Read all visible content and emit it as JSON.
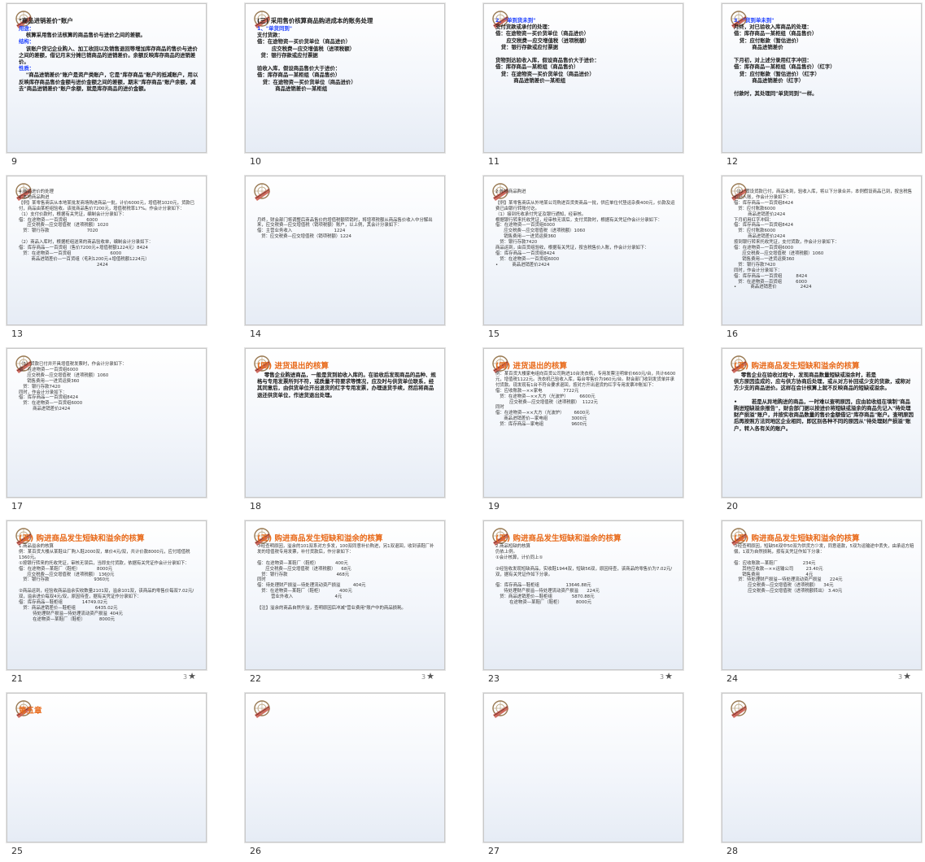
{
  "slides": [
    {
      "num": "9",
      "lines": [
        {
          "c": "t-title",
          "t": "\"商品进销差价\"账户"
        },
        {
          "c": "t-blue",
          "t": "用途："
        },
        {
          "c": "b",
          "t": "    核算采用售价法核算的商品售价与进价之间的差额。"
        },
        {
          "c": "t-blue",
          "t": "结构："
        },
        {
          "c": "b",
          "t": "    该账户贷记企业购入、加工收回以及销售退回等增加库存商品的售价与进价之间的差额，借记月末分摊已销商品的进销差价。余额反映库存商品的进销差价。"
        },
        {
          "c": "t-blue",
          "t": "性质："
        },
        {
          "c": "b",
          "t": "    \"商品进销差价\"账户是资产类账户，它是\"库存商品\"账户的抵减账户，用以反映库存商品售价金额与进价金额之间的差额，期末\"库存商品\"账户余额，减去\"商品进销差价\"账户余额，就是库存商品的进价金额。"
        }
      ]
    },
    {
      "num": "10",
      "lines": [
        {
          "c": "t-title",
          "t": "(三) 采用售价核算商品购进成本的账务处理"
        },
        {
          "c": "t-blue",
          "t": "1、\"单货同到\""
        },
        {
          "c": "b",
          "t": "支付货款："
        },
        {
          "c": "b",
          "t": "借：在途物资—买价货单位（商品进价）"
        },
        {
          "c": "b",
          "t": "        应交税费—应交增值税（进项税额）"
        },
        {
          "c": "b",
          "t": "  贷：银行存款或应付票据"
        },
        {
          "c": "b",
          "t": " "
        },
        {
          "c": "b",
          "t": "验收入库，假设商品售价大于进价："
        },
        {
          "c": "b",
          "t": "借：库存商品—某柜组（商品售价）"
        },
        {
          "c": "b",
          "t": "   贷：在途物资—买价货单位（商品进价）"
        },
        {
          "c": "b",
          "t": "          商品进销差价—某柜组"
        }
      ]
    },
    {
      "num": "11",
      "lines": [
        {
          "c": "t-blue",
          "t": "2、\"单到货未到\""
        },
        {
          "c": "b",
          "t": "支付货款或承付的处理："
        },
        {
          "c": "b",
          "t": "借：在途物资—买价货单位（商品进价）"
        },
        {
          "c": "b",
          "t": "      应交税费—应交增值税（进项税额）"
        },
        {
          "c": "b",
          "t": "   贷：银行存款或应付票据"
        },
        {
          "c": "b",
          "t": " "
        },
        {
          "c": "b",
          "t": "货物到达验收入库，假设商品售价大于进价："
        },
        {
          "c": "b",
          "t": "借：库存商品—某柜组（商品售价）"
        },
        {
          "c": "b",
          "t": "   贷：在途物资—买价货单位（商品进价）"
        },
        {
          "c": "b",
          "t": "          商品进销差价—某柜组"
        }
      ]
    },
    {
      "num": "12",
      "lines": [
        {
          "c": "t-blue",
          "t": "3、\"货到单未到\""
        },
        {
          "c": "b",
          "t": "月终，对已验收入库商品的处理："
        },
        {
          "c": "b",
          "t": "借：库存商品—某柜组（商品售价）"
        },
        {
          "c": "b",
          "t": "   贷：应付账款（暂估进价）"
        },
        {
          "c": "b",
          "t": "          商品进销差价"
        },
        {
          "c": "b",
          "t": " "
        },
        {
          "c": "b",
          "t": "下月初，对上述分录用红字冲回："
        },
        {
          "c": "b",
          "t": "借：库存商品—某柜组（商品售价）（红字）"
        },
        {
          "c": "b",
          "t": "   贷：应付账款（暂估进价）（红字）"
        },
        {
          "c": "b",
          "t": "          商品进销差价（红字）"
        },
        {
          "c": "b",
          "t": " "
        },
        {
          "c": "b",
          "t": "付款时，其处理同\"单货同到\"一样。"
        }
      ]
    },
    {
      "num": "13",
      "dense": true,
      "lines": [
        {
          "c": "",
          "t": "4.商品进价的处理"
        },
        {
          "c": "",
          "t": "1.本地商品购进"
        },
        {
          "c": "",
          "t": "【例】某零售商店从本地某批发商场购进商品一批，计价6000元，增值税1020元，货款已付，商品由某柜组验收。该批商品售价7200元，增值税税率17%。作会计分录如下："
        },
        {
          "c": "",
          "t": "（1）支付价款时，根据有关凭证，编制会计分录如下："
        },
        {
          "c": "",
          "t": "借：在途物资—一百货组              6000"
        },
        {
          "c": "",
          "t": "      应交税费—应交增值税（进项税额）1020"
        },
        {
          "c": "",
          "t": "   贷：银行存款                           7020"
        },
        {
          "c": "",
          "t": " "
        },
        {
          "c": "",
          "t": "（2）商品入库时，根据柜组送来的商品验收单，编制会计分录如下："
        },
        {
          "c": "",
          "t": "借：库存商品—一百货组（售价7200元+增值税额1224元）8424"
        },
        {
          "c": "",
          "t": "   贷：在途物资—一百货组                            6000"
        },
        {
          "c": "",
          "t": "         商品进销差价—一百货组（毛利1200元+增值税额1224元）"
        },
        {
          "c": "",
          "t": "                                                        2424"
        }
      ]
    },
    {
      "num": "14",
      "dense": true,
      "lines": [
        {
          "c": "",
          "t": " "
        },
        {
          "c": "",
          "t": " "
        },
        {
          "c": "",
          "t": " "
        },
        {
          "c": "",
          "t": " "
        },
        {
          "c": "",
          "t": " "
        },
        {
          "c": "",
          "t": "月终，财会部门将调整后商品售价的增值税额转销时，将增项税额从商品售价收入中分解出来，应交税费—应交增值税（销项税额）账户，以上例，其会计分录如下："
        },
        {
          "c": "",
          "t": "借：主营业务收入                              1224"
        },
        {
          "c": "",
          "t": "   贷：应交税费—应交增值税（销项税额）1224"
        }
      ]
    },
    {
      "num": "15",
      "dense": true,
      "lines": [
        {
          "c": "",
          "t": "2.外地商品购进"
        },
        {
          "c": "",
          "t": " "
        },
        {
          "c": "",
          "t": "【例】某零售商店从外地某公司购进百货类商品一批，供应单位代垫运杂费400元，价款及运费已由银行转账付讫。"
        },
        {
          "c": "",
          "t": "（1）接到托收承付凭证及银行通知，经审核。"
        },
        {
          "c": "",
          "t": "根据银行转来托收凭证，经审核无误后，支付货款时，根据有关凭证作会计分录如下："
        },
        {
          "c": "",
          "t": "借：在途物资—一百货组6000"
        },
        {
          "c": "",
          "t": "      应交税费—应交增值税（进项税额）1060"
        },
        {
          "c": "",
          "t": "      销售费用—一进货运费360"
        },
        {
          "c": "",
          "t": "   贷：银行存款7420"
        },
        {
          "c": "",
          "t": "商品运到，由百货组验收，根据有关凭证，按含税售价入账，作会计分录如下："
        },
        {
          "c": "",
          "t": "借：库存商品—一百货组8424"
        },
        {
          "c": "",
          "t": "   贷：在途物资—一百货组6000"
        },
        {
          "c": "",
          "t": "•          商品进销差价2424"
        }
      ]
    },
    {
      "num": "16",
      "dense": true,
      "lines": [
        {
          "c": "",
          "t": "（2）假设货款已付，商品未到，验收入库，将以下分录合并。本例假设商品已到，按含税售价记入账，作会计分录如下："
        },
        {
          "c": "",
          "t": "借：库存商品—一百货组8424"
        },
        {
          "c": "",
          "t": "   贷：应付账款6000"
        },
        {
          "c": "",
          "t": "          商品进销差价2424"
        },
        {
          "c": "",
          "t": "下月初用红字冲回："
        },
        {
          "c": "",
          "t": "借：库存商品—一百货组8424"
        },
        {
          "c": "",
          "t": "   贷：应付账款6000"
        },
        {
          "c": "",
          "t": "          商品进销差价2424"
        },
        {
          "c": "",
          "t": "按到银行转来托收凭证，支付货款，作会计分录如下："
        },
        {
          "c": "",
          "t": "借：在途物资—一百货组6000"
        },
        {
          "c": "",
          "t": "      应交税费—应交增值税（进项税额）1060"
        },
        {
          "c": "",
          "t": "      销售费用—一进货运费360"
        },
        {
          "c": "",
          "t": "   贷：银行存款7420"
        },
        {
          "c": "",
          "t": "同时，作会计分录如下："
        },
        {
          "c": "",
          "t": "借：库存商品—一百货组          8424"
        },
        {
          "c": "",
          "t": "   贷：在途物资—百货组          6000"
        },
        {
          "c": "",
          "t": "•          商品进销差价                 2424"
        }
      ]
    },
    {
      "num": "17",
      "dense": true,
      "lines": [
        {
          "c": "",
          "t": "（3）货款已付并开具增值税发票时，作会计分录如下："
        },
        {
          "c": "",
          "t": "借：在途物资—一百货组6000"
        },
        {
          "c": "",
          "t": "      应交税费—应交增值税（进项税额）1060"
        },
        {
          "c": "",
          "t": "      销售费用—一进货运费360"
        },
        {
          "c": "",
          "t": "   贷：银行存款7420"
        },
        {
          "c": "",
          "t": "同时，作会计分录如下："
        },
        {
          "c": "",
          "t": "借：库存商品—一百货组8424"
        },
        {
          "c": "",
          "t": "   贷：在途物资—一百货组6000"
        },
        {
          "c": "",
          "t": "          商品进销差价2424"
        }
      ]
    },
    {
      "num": "18",
      "lines": [
        {
          "c": "t-orange",
          "t": "(四) 进货退出的核算"
        },
        {
          "c": "b",
          "t": "    零售企业购进商品，一般是货到验收入库的。在验收后发现商品的品种、规格与专用发票所列不符，或质量不符要求等情况，应及时与供货单位联系，经其同意后，由供货单位开出退货的红字专用发票，办理退货手续，然后将商品退还供货单位，作进货退出处理。"
        }
      ]
    },
    {
      "num": "19",
      "dense": true,
      "lines": [
        {
          "c": "t-orange",
          "t": "(四) 进货退出的核算"
        },
        {
          "c": "",
          "t": "例：某百货大楼家电组向百货公司购进10台洗衣机，专用发票注明单价660元/台，共计6600元，增值税1122元。洗衣机已验收入库，每台零售价为960元/台。财会部门收到发货单并承付货款。现发现有1台不符合要求退回，按对方开出退货的红字专用发票冲账如下："
        },
        {
          "c": "",
          "t": "借：应收账款—××家电               7722元"
        },
        {
          "c": "",
          "t": "   贷：在途物资—××大方（光波炉）        6600元"
        },
        {
          "c": "",
          "t": "          应交税费—应交增值税（进项税额）  1122元"
        },
        {
          "c": "",
          "t": "同时"
        },
        {
          "c": "",
          "t": "借：在途物资—××大方（光波炉）       6600元"
        },
        {
          "c": "",
          "t": "      商品进销差价—家电组                 3000元"
        },
        {
          "c": "",
          "t": "   贷：库存商品—家电组                    9600元"
        }
      ]
    },
    {
      "num": "20",
      "lines": [
        {
          "c": "t-orange",
          "t": "(五) 购进商品发生短缺和溢余的核算"
        },
        {
          "c": "b",
          "t": "    零售企业在验收过程中，发现商品数量短缺或溢余时，若是"
        },
        {
          "c": "b",
          "t": "供方原因造成的，应与供方协商后处理，或从对方补回或少支的货款，或称对方少支的商品进价。这样在会计核算上就不反映商品的短缺或溢余。"
        },
        {
          "c": "b",
          "t": " "
        },
        {
          "c": "b",
          "t": "•        若是从异地购进的商品，一时难以查明原因，应由验收组在填制\"商品购进短缺溢余报告\"，财会部门据以按进价将短缺或溢余的商品先记入\"待处理财产损溢\"账户，并按实收商品数量的售价金额借记\"库存商品\"账户。查明原因后再按照方法同地区企业相同，即区别各种不同的原因从\"待处理财产损溢\"账户，转入各有关的账户。"
        }
      ]
    },
    {
      "num": "21",
      "star": true,
      "dense": true,
      "lines": [
        {
          "c": "t-orange",
          "t": "(五) 购进商品发生短缺和溢余的核算"
        },
        {
          "c": "",
          "t": "1.商品溢余的核算"
        },
        {
          "c": "",
          "t": "例：某百货大楼从某鞋业厂购入鞋2000双，单价4元/双，共计价款8000元，应付增值税1360元。"
        },
        {
          "c": "",
          "t": "①按银行转来的托收凭证，审核无误后，当即支付货款，依据有关凭证作会计分录如下："
        },
        {
          "c": "",
          "t": "借：在途物资—某鞋厂（鞋柜）            8000元"
        },
        {
          "c": "",
          "t": "      应交税费—应交增值税（进项税额） 1360元"
        },
        {
          "c": "",
          "t": "   贷：银行存款                                9360元"
        },
        {
          "c": "",
          "t": " "
        },
        {
          "c": "",
          "t": "②商品运到，经验收商品溢余实收数量2101双，溢余101双，该商品的零售价每双7.02元/双，溢余进价每双4元/双，原因待查，据有关凭证作分录如下："
        },
        {
          "c": "",
          "t": "借：库存商品—鞋柜组              14749.02元"
        },
        {
          "c": "",
          "t": "   贷：商品进销差价—鞋柜组              6435.02元"
        },
        {
          "c": "",
          "t": "          待处理财产损溢—待处理流动资产损溢  404元"
        },
        {
          "c": "",
          "t": "          在途物资—某鞋厂（鞋柜）          8000元"
        }
      ]
    },
    {
      "num": "22",
      "star": true,
      "dense": true,
      "lines": [
        {
          "c": "t-orange",
          "t": "(五) 购进商品发生短缺和溢余的核算"
        },
        {
          "c": "",
          "t": "③经查明原因，溢余的101双系对方多发，100双同意补价购进，另1双退回，收到该鞋厂补发的增值税专用发票，补付货款后，作分录如下："
        },
        {
          "c": "",
          "t": " "
        },
        {
          "c": "",
          "t": "借：在途物资—某鞋厂（鞋柜）            400元"
        },
        {
          "c": "",
          "t": "      应交税费—应交增值税（进项税额）    68元"
        },
        {
          "c": "",
          "t": "   贷：银行存款                                   468元"
        },
        {
          "c": "",
          "t": "同时"
        },
        {
          "c": "",
          "t": "借：待处理财产损溢—待处理流动资产损溢         404元"
        },
        {
          "c": "",
          "t": "   贷：在途物资—某鞋厂（鞋柜）            400元"
        },
        {
          "c": "",
          "t": "          营业外收入                              4元"
        },
        {
          "c": "",
          "t": " "
        },
        {
          "c": "",
          "t": "【注】溢余的商品自然升溢，查明原因后冲减\"营业费用\"账户中的商品损耗。"
        }
      ]
    },
    {
      "num": "23",
      "star": true,
      "dense": true,
      "lines": [
        {
          "c": "t-orange",
          "t": "(五) 购进商品发生短缺和溢余的核算"
        },
        {
          "c": "",
          "t": "2.商品短缺的核算"
        },
        {
          "c": "",
          "t": "仍依上例。"
        },
        {
          "c": "",
          "t": "①会计核算，计价同上①"
        },
        {
          "c": "",
          "t": " "
        },
        {
          "c": "",
          "t": "②经验收发现短缺商品，实收鞋1944双，短缺56双，原因待查，该商品的零售价为7.02元/双，据有关凭证作如下分录。"
        },
        {
          "c": "",
          "t": " "
        },
        {
          "c": "",
          "t": "借：库存商品—鞋柜组                   13646.88元"
        },
        {
          "c": "",
          "t": "      待处理财产损溢—待处理流动资产损溢      224元"
        },
        {
          "c": "",
          "t": "   贷：商品进销差价—鞋柜组              5870.88元"
        },
        {
          "c": "",
          "t": "          在途物资—某鞋厂（鞋柜）          8000元"
        }
      ]
    },
    {
      "num": "24",
      "star": true,
      "dense": true,
      "lines": [
        {
          "c": "t-orange",
          "t": "(五) 购进商品发生短缺和溢余的核算"
        },
        {
          "c": "",
          "t": "③经查明原因，短缺56双中50双为供货方少发，同意退款，5双为运输途中丢失，由承运方赔偿，1双为自然损耗，按有关凭证作如下分录："
        },
        {
          "c": "",
          "t": " "
        },
        {
          "c": "",
          "t": "借：应收账款—某鞋厂                  234元"
        },
        {
          "c": "",
          "t": "      其他应收款—××运输公司         23.40元"
        },
        {
          "c": "",
          "t": "      销售费用                                 4元"
        },
        {
          "c": "",
          "t": "   贷：待处理财产损溢—待处理流动资产损溢      224元"
        },
        {
          "c": "",
          "t": "          应交税费—应交增值税（进项税额）    34元"
        },
        {
          "c": "",
          "t": "          应交税费—应交增值税（进项税额转出） 3.40元"
        }
      ]
    },
    {
      "num": "25",
      "lines": [
        {
          "c": "t-orange",
          "t": "第五章"
        }
      ]
    },
    {
      "num": "26",
      "lines": []
    },
    {
      "num": "27",
      "lines": []
    },
    {
      "num": "28",
      "lines": []
    }
  ],
  "colors": {
    "accent_blue": "#1e40ff",
    "accent_orange": "#e86a1a",
    "selection": "#8fb3e6"
  },
  "icons": {
    "slide_logo": "compass-scroll-icon",
    "rating": "star-icon"
  }
}
